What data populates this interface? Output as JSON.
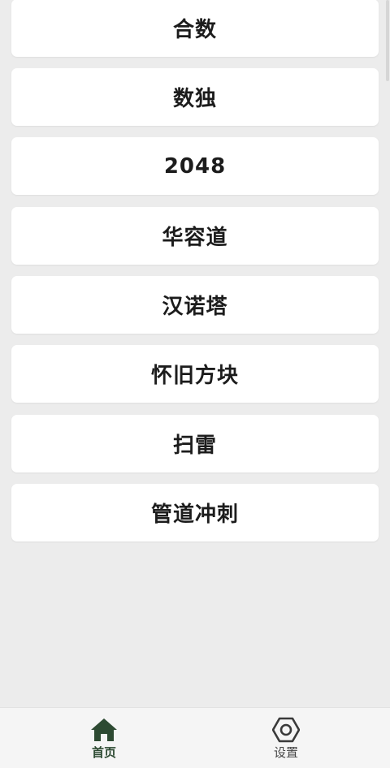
{
  "games": [
    {
      "label": "合数"
    },
    {
      "label": "数独"
    },
    {
      "label": "2048"
    },
    {
      "label": "华容道"
    },
    {
      "label": "汉诺塔"
    },
    {
      "label": "怀旧方块"
    },
    {
      "label": "扫雷"
    },
    {
      "label": "管道冲刺"
    }
  ],
  "tabbar": {
    "home": {
      "label": "首页",
      "icon": "home-icon",
      "active": true
    },
    "settings": {
      "label": "设置",
      "icon": "settings-icon",
      "active": false
    }
  },
  "colors": {
    "background": "#ececec",
    "card": "#ffffff",
    "text": "#1c1c1c",
    "tab_active": "#2d4a32",
    "tab_inactive": "#444444"
  }
}
